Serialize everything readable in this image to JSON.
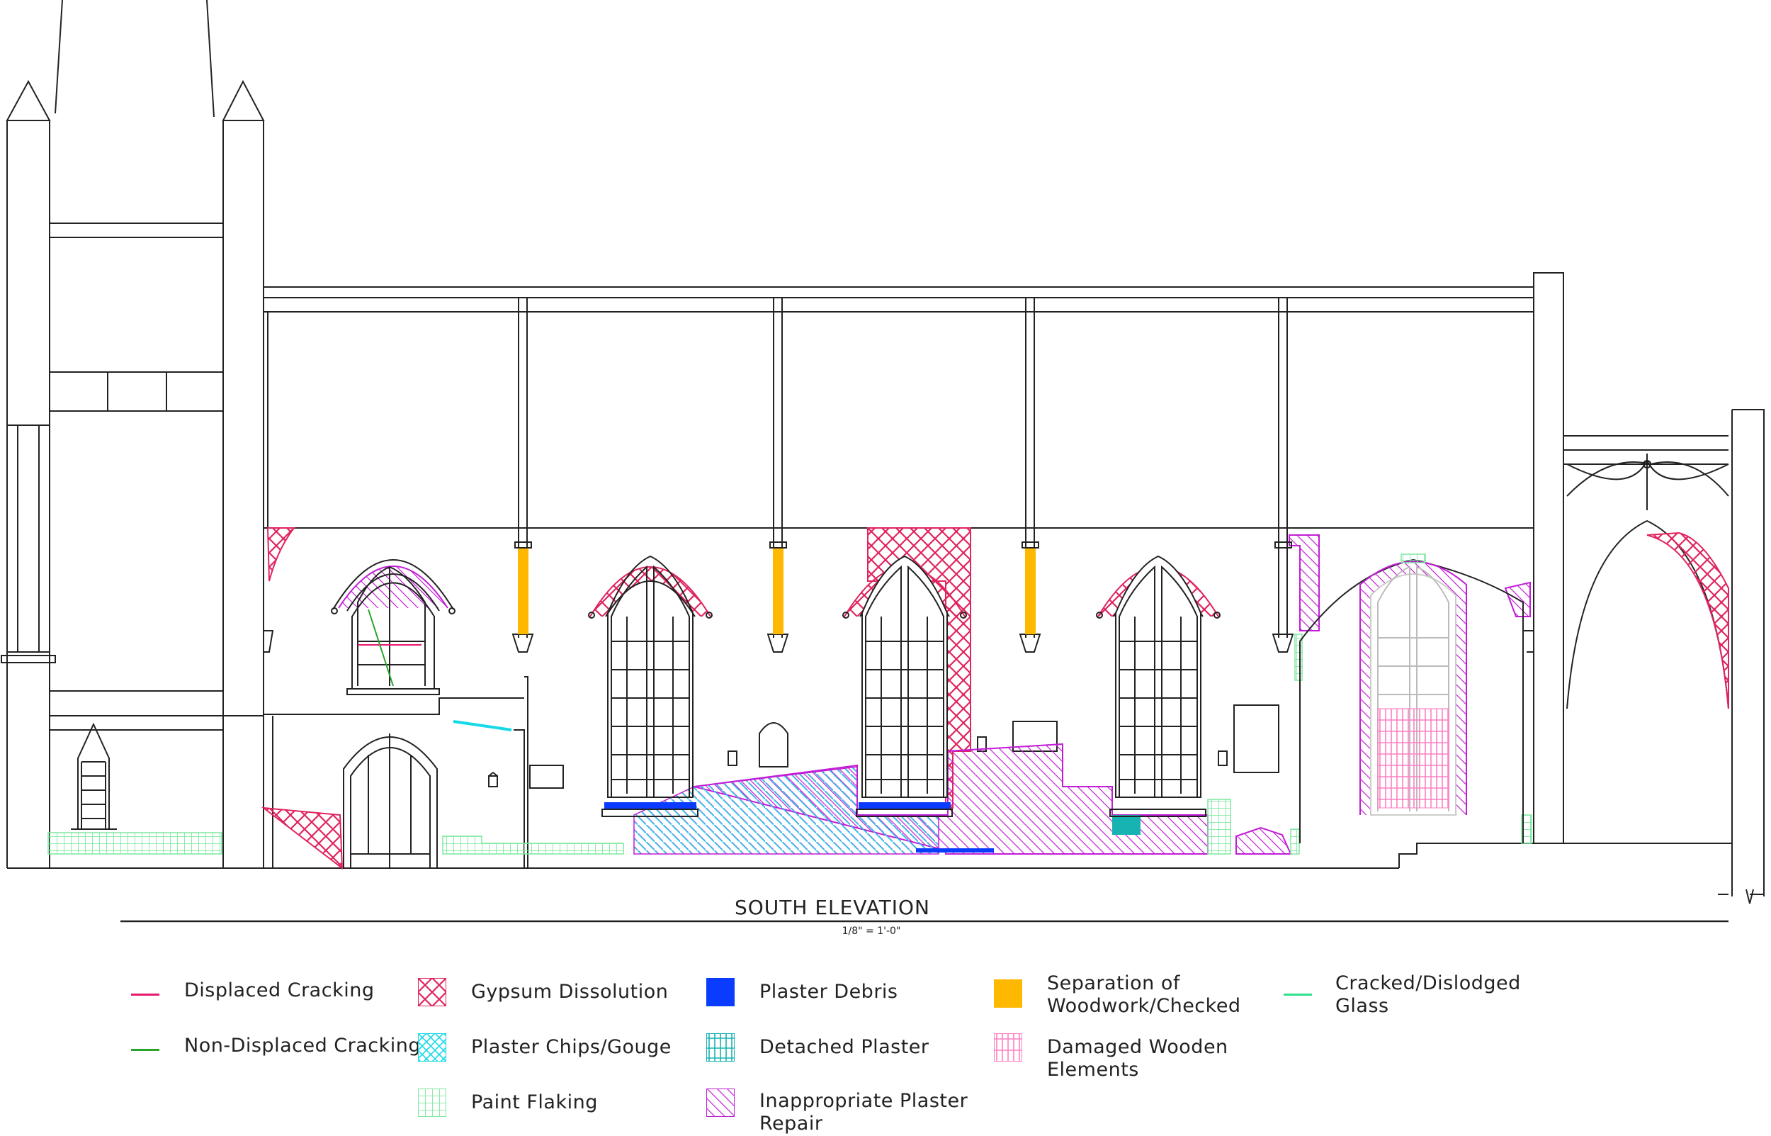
{
  "title": "SOUTH ELEVATION",
  "scale": "1/8\" = 1'-0\"",
  "legend": {
    "displaced_cracking": "Displaced Cracking",
    "non_displaced_cracking": "Non-Displaced Cracking",
    "gypsum_dissolution": "Gypsum Dissolution",
    "plaster_chips_gouge": "Plaster Chips/Gouge",
    "paint_flaking": "Paint Flaking",
    "plaster_debris": "Plaster Debris",
    "detached_plaster": "Detached Plaster",
    "inappropriate_repair_1": "Inappropriate Plaster",
    "inappropriate_repair_2": "Repair",
    "separation_1": "Separation of",
    "separation_2": "Woodwork/Checked",
    "damaged_wood_1": "Damaged Wooden",
    "damaged_wood_2": "Elements",
    "cracked_glass_1": "Cracked/Dislodged",
    "cracked_glass_2": "Glass"
  },
  "colors": {
    "displaced_cracking": "#e8186d",
    "non_displaced_cracking": "#2aa52a",
    "gypsum_dissolution": "#e0245e",
    "plaster_chips_gouge": "#16d9e8",
    "paint_flaking": "#7ee9a0",
    "plaster_debris": "#0a3cff",
    "detached_plaster": "#17b3b3",
    "inappropriate_repair": "#c21dd6",
    "separation": "#ffb800",
    "damaged_wood": "#ff7fc4",
    "cracked_glass": "#2fe08a",
    "linework": "#222222"
  }
}
